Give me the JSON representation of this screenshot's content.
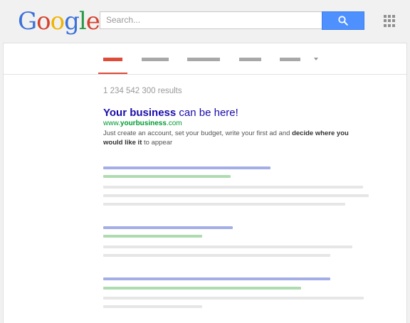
{
  "logo": {
    "letters": [
      "G",
      "o",
      "o",
      "g",
      "l",
      "e"
    ],
    "colors": [
      "#3b72d8",
      "#d5412f",
      "#f0b400",
      "#3b72d8",
      "#2a9a47",
      "#d5412f"
    ]
  },
  "search": {
    "placeholder": "Search...",
    "button_icon": "search-icon"
  },
  "apps_icon": "apps-grid-icon",
  "tabs": [
    {
      "name": "tab-1",
      "active": true
    },
    {
      "name": "tab-2",
      "active": false
    },
    {
      "name": "tab-3",
      "active": false
    },
    {
      "name": "tab-4",
      "active": false
    },
    {
      "name": "tab-5",
      "active": false
    }
  ],
  "more_icon": "chevron-down-icon",
  "results": {
    "count_text": "1 234 542 300 results"
  },
  "ad": {
    "title_bold": "Your business",
    "title_rest": " can be here!",
    "url_prefix": "www.",
    "url_bold": "yourbusiness",
    "url_suffix": ".com",
    "desc_part1": "Just create an account, set your budget, write your first ad and ",
    "desc_bold1": "decide where you would like it",
    "desc_part2": " to appear"
  },
  "colors": {
    "accent_red": "#dd4b39",
    "search_blue": "#4d90fe",
    "link_blue": "#1a0dab",
    "url_green": "#009933"
  }
}
